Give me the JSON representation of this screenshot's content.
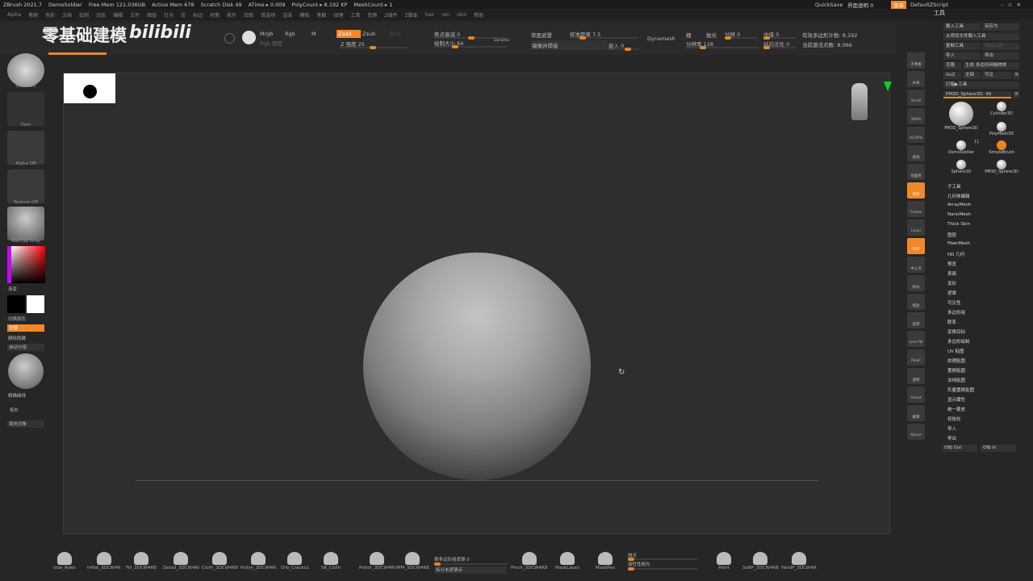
{
  "titlebar": {
    "app": "ZBrush 2021.7",
    "doc": "DemoSoldier",
    "free_mem": "Free Mem 121.036GB",
    "active_mem": "Active Mem 678",
    "scratch": "Scratch Disk 49",
    "atime": "ATime ▸ 0.009",
    "polycount": "PolyCount ▸ 8.192 KP",
    "meshcount": "MeshCount ▸ 1",
    "quicksave": "QuickSave",
    "transparency": "界面透明 0",
    "menu_btn": "菜单",
    "script": "DefaultZScript"
  },
  "menus": [
    "Alpha",
    "笔刷",
    "色彩",
    "文档",
    "绘制",
    "动态",
    "编辑",
    "文件",
    "图层",
    "灯光",
    "宏",
    "标记",
    "材质",
    "影片",
    "拾取",
    "首选项",
    "渲染",
    "模板",
    "笔触",
    "纹理",
    "工具",
    "变换",
    "Z插件",
    "Z脚本",
    "hair",
    "ren",
    "skin",
    "帮助"
  ],
  "watermark": {
    "text": "零基础建模",
    "logo": "bilibili"
  },
  "toolbar": {
    "mrgb": "Mrgb",
    "rgb": "Rgb",
    "m": "M",
    "rgb_strength": "Rgb 强度",
    "zadd": "Zadd",
    "zsub": "Zsub",
    "zcut": "Zcut",
    "z_intensity": "Z 强度 25",
    "focal_shift": "焦点衰减 0",
    "draw_size": "绘制大小 64",
    "dynamic": "Dynamic",
    "backface": "背面遮罩",
    "lazy_radius": "校准距离 7.5",
    "mirror_merge": "镜像并焊接",
    "inset": "嵌入 0",
    "dynamesh": "Dynamesh",
    "fine": "细",
    "smooth": "抛光",
    "subdiv": "分辨 0",
    "resolution": "分辨率 128",
    "mid": "中值 0",
    "dir_smooth": "延向法化 0",
    "active_poly": "有效多边形计数: 8,192",
    "active_points": "当前激活点数: 8,066"
  },
  "left": {
    "brush": "Standard",
    "stroke": "Dots",
    "alpha": "Alpha Off",
    "texture": "Texture Off",
    "material": "MatCap Gray",
    "gradient": "渐变",
    "switch_color": "切换颜色",
    "alternate": "交替",
    "remove_hidden": "删除隐藏",
    "auto_group": "自动分组",
    "lazy_curve": "精确曲线",
    "topology": "拓扑",
    "fill_object": "填充对象"
  },
  "right_tools": [
    "子像素",
    "米格",
    "Scroll",
    "100%",
    "AC50%",
    "透视",
    "地面格",
    "对齐",
    "Frame",
    "Local",
    "XYZ",
    "中心点",
    "移动",
    "缩放",
    "旋转",
    "Line Fill",
    "PolyF",
    "透明",
    "Ghost",
    "解算",
    "Xpose"
  ],
  "rpanel": {
    "title": "工具",
    "load": "载入工具",
    "save_as": "另存为",
    "load_project": "从项目文件载入工具",
    "copy": "复制工具",
    "paste": "粘贴工具",
    "import": "导入",
    "export": "导出",
    "clone": "克隆",
    "make_polymesh": "生成 多边形网格物体",
    "goz": "GoZ",
    "all": "全部",
    "visible": "可见",
    "r": "R",
    "lightbox": "灯箱▶工具",
    "current_tool": "PM3D_Sphere3D. 49",
    "tools": [
      "PM3D_Sphere3D",
      "Cylinder3D",
      "PolyMesh3D",
      "DemoSoldier",
      "SimpleBrush",
      "Sphere3D",
      "PM3D_Sphere3D"
    ],
    "demo_count": "11",
    "menu": [
      "子工具",
      "几何体编辑",
      "ArrayMesh",
      "NanoMesh",
      "Thick Skin",
      "图层",
      "FiberMesh",
      "HD 几何",
      "预览",
      "表面",
      "变形",
      "遮罩",
      "可见性",
      "多边形组",
      "联系",
      "变换目标",
      "多边形绘制",
      "UV 贴图",
      "纹理贴图",
      "置换贴图",
      "法线贴图",
      "矢量置换贴图",
      "显示属性",
      "统一蒙皮",
      "初始化",
      "导入",
      "导出"
    ],
    "obj_out": "OBJ Out",
    "obj_in": "OBJ In"
  },
  "bottom": {
    "brushes": [
      "sida_Rake",
      "Inflat_3DCW4R",
      "Fill_3DCW4R8",
      "Detail_3DCW4RI",
      "Cloth_3DCW4R8",
      "Polish_3DCW4RI",
      "Orb_Cracks1",
      "SK_Cloth",
      "Polish_3DCW4RI",
      "IMM_3DCW4R8"
    ],
    "polygroup_blur": "拨多边形组遮罩 0",
    "split_unmasked": "拆分未遮罩点",
    "brushes2": [
      "Pinch_3DCW4R8",
      "MaskLasso",
      "MaskPen"
    ],
    "smooth_label": "抛光",
    "smooth_stronger": "接性性抛光",
    "brushes3": [
      "Paint",
      "SoftP_3DCW4R8",
      "HardP_3DCW4R"
    ]
  }
}
